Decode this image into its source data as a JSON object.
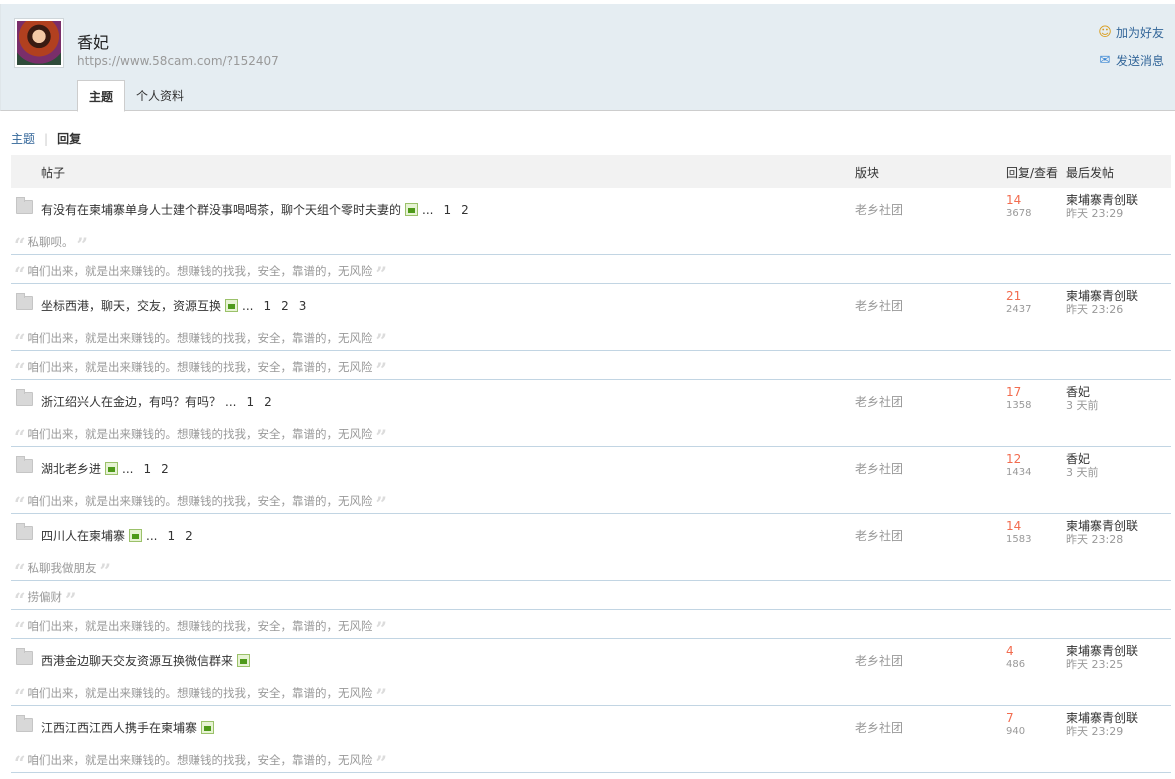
{
  "profile": {
    "name": "香妃",
    "url": "https://www.58cam.com/?152407",
    "actions": {
      "add_friend": "加为好友",
      "send_message": "发送消息"
    },
    "tabs": [
      "主题",
      "个人资料"
    ]
  },
  "subnav": {
    "topics": "主题",
    "replies": "回复"
  },
  "columns": {
    "post": "帖子",
    "forum": "版块",
    "counts": "回复/查看",
    "last": "最后发帖"
  },
  "threads": [
    {
      "title": "有没有在柬埔寨单身人士建个群没事喝喝茶，聊个天组个零时夫妻的",
      "ellipsis": "...",
      "pages": [
        "1",
        "2"
      ],
      "forum": "老乡社团",
      "replies": "14",
      "views": "3678",
      "last_author": "柬埔寨青创联",
      "last_time": "昨天 23:29",
      "quotes": [
        "私聊呗。",
        "咱们出来，就是出来赚钱的。想赚钱的找我，安全，靠谱的，无风险"
      ]
    },
    {
      "title": "坐标西港，聊天，交友，资源互换",
      "ellipsis": "...",
      "pages": [
        "1",
        "2",
        "3"
      ],
      "forum": "老乡社团",
      "replies": "21",
      "views": "2437",
      "last_author": "柬埔寨青创联",
      "last_time": "昨天 23:26",
      "quotes": [
        "咱们出来，就是出来赚钱的。想赚钱的找我，安全，靠谱的，无风险",
        "咱们出来，就是出来赚钱的。想赚钱的找我，安全，靠谱的，无风险"
      ]
    },
    {
      "title": "浙江绍兴人在金边，有吗？有吗？",
      "ellipsis": "...",
      "pages": [
        "1",
        "2"
      ],
      "forum": "老乡社团",
      "replies": "17",
      "views": "1358",
      "last_author": "香妃",
      "last_time": "3 天前",
      "quotes": [
        "咱们出来，就是出来赚钱的。想赚钱的找我，安全，靠谱的，无风险"
      ]
    },
    {
      "title": "湖北老乡进",
      "ellipsis": "...",
      "pages": [
        "1",
        "2"
      ],
      "forum": "老乡社团",
      "replies": "12",
      "views": "1434",
      "last_author": "香妃",
      "last_time": "3 天前",
      "quotes": [
        "咱们出来，就是出来赚钱的。想赚钱的找我，安全，靠谱的，无风险"
      ]
    },
    {
      "title": "四川人在柬埔寨",
      "ellipsis": "...",
      "pages": [
        "1",
        "2"
      ],
      "forum": "老乡社团",
      "replies": "14",
      "views": "1583",
      "last_author": "柬埔寨青创联",
      "last_time": "昨天 23:28",
      "quotes": [
        "私聊我做朋友",
        "捞偏财",
        "咱们出来，就是出来赚钱的。想赚钱的找我，安全，靠谱的，无风险"
      ]
    },
    {
      "title": "西港金边聊天交友资源互换微信群来",
      "ellipsis": "",
      "pages": [],
      "forum": "老乡社团",
      "replies": "4",
      "views": "486",
      "last_author": "柬埔寨青创联",
      "last_time": "昨天 23:25",
      "quotes": [
        "咱们出来，就是出来赚钱的。想赚钱的找我，安全，靠谱的，无风险"
      ]
    },
    {
      "title": "江西江西江西人携手在柬埔寨",
      "ellipsis": "",
      "pages": [],
      "forum": "老乡社团",
      "replies": "7",
      "views": "940",
      "last_author": "柬埔寨青创联",
      "last_time": "昨天 23:29",
      "quotes": [
        "咱们出来，就是出来赚钱的。想赚钱的找我，安全，靠谱的，无风险"
      ]
    }
  ]
}
